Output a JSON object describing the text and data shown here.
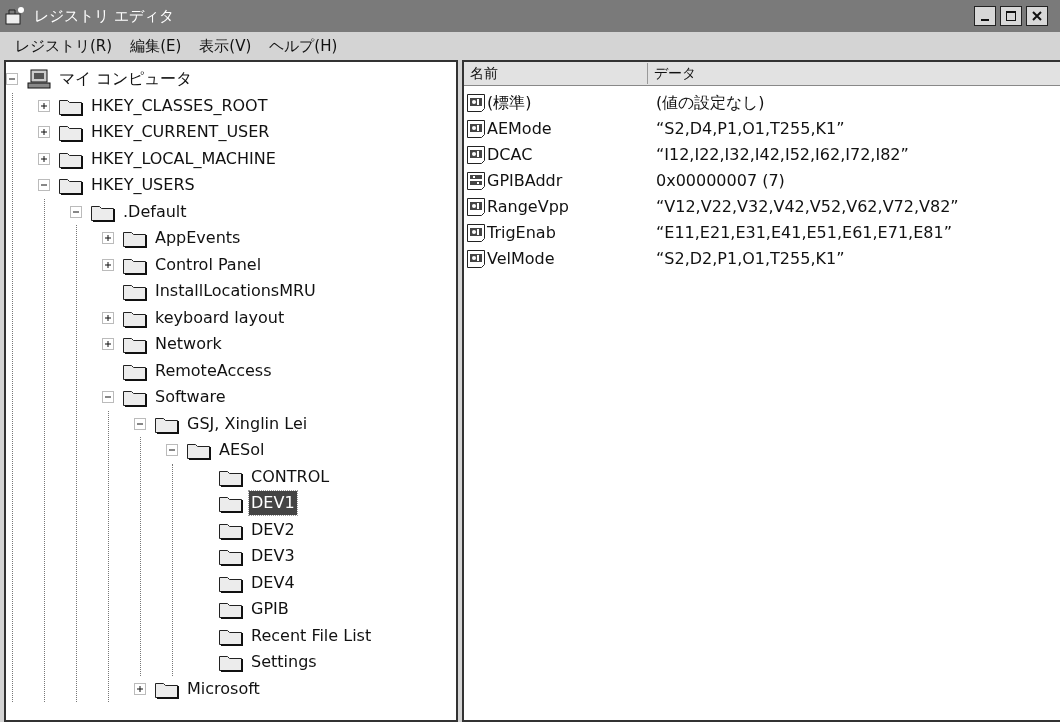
{
  "window": {
    "title": "レジストリ エディタ"
  },
  "menu": [
    "レジストリ(R)",
    "編集(E)",
    "表示(V)",
    "ヘルプ(H)"
  ],
  "tree": {
    "label": "マイ コンピュータ",
    "kind": "computer",
    "expanded": true,
    "selected": false,
    "children": [
      {
        "label": "HKEY_CLASSES_ROOT",
        "kind": "folder",
        "expanded": false,
        "selected": false
      },
      {
        "label": "HKEY_CURRENT_USER",
        "kind": "folder",
        "expanded": false,
        "selected": false
      },
      {
        "label": "HKEY_LOCAL_MACHINE",
        "kind": "folder",
        "expanded": false,
        "selected": false
      },
      {
        "label": "HKEY_USERS",
        "kind": "folder",
        "expanded": true,
        "selected": false,
        "children": [
          {
            "label": ".Default",
            "kind": "folder",
            "expanded": true,
            "selected": false,
            "children": [
              {
                "label": "AppEvents",
                "kind": "folder",
                "expanded": false,
                "selected": false
              },
              {
                "label": "Control Panel",
                "kind": "folder",
                "expanded": false,
                "selected": false
              },
              {
                "label": "InstallLocationsMRU",
                "kind": "folder",
                "selected": false
              },
              {
                "label": "keyboard layout",
                "kind": "folder",
                "expanded": false,
                "selected": false
              },
              {
                "label": "Network",
                "kind": "folder",
                "expanded": false,
                "selected": false
              },
              {
                "label": "RemoteAccess",
                "kind": "folder",
                "selected": false
              },
              {
                "label": "Software",
                "kind": "folder",
                "expanded": true,
                "selected": false,
                "children": [
                  {
                    "label": "GSJ, Xinglin Lei",
                    "kind": "folder",
                    "expanded": true,
                    "selected": false,
                    "children": [
                      {
                        "label": "AESol",
                        "kind": "folder",
                        "expanded": true,
                        "selected": false,
                        "children": [
                          {
                            "label": "CONTROL",
                            "kind": "folder",
                            "selected": false
                          },
                          {
                            "label": "DEV1",
                            "kind": "folder",
                            "selected": true
                          },
                          {
                            "label": "DEV2",
                            "kind": "folder",
                            "selected": false
                          },
                          {
                            "label": "DEV3",
                            "kind": "folder",
                            "selected": false
                          },
                          {
                            "label": "DEV4",
                            "kind": "folder",
                            "selected": false
                          },
                          {
                            "label": "GPIB",
                            "kind": "folder",
                            "selected": false
                          },
                          {
                            "label": "Recent File List",
                            "kind": "folder",
                            "selected": false
                          },
                          {
                            "label": "Settings",
                            "kind": "folder",
                            "selected": false
                          }
                        ]
                      }
                    ]
                  },
                  {
                    "label": "Microsoft",
                    "kind": "folder",
                    "expanded": false,
                    "selected": false
                  }
                ]
              }
            ]
          }
        ]
      }
    ]
  },
  "values": {
    "columns": [
      "名前",
      "データ"
    ],
    "rows": [
      {
        "kind": "string",
        "name": "(標準)",
        "data": "(値の設定なし)"
      },
      {
        "kind": "string",
        "name": "AEMode",
        "data": "“S2,D4,P1,O1,T255,K1”"
      },
      {
        "kind": "string",
        "name": "DCAC",
        "data": "“I12,I22,I32,I42,I52,I62,I72,I82”"
      },
      {
        "kind": "binary",
        "name": "GPIBAddr",
        "data": "0x00000007 (7)"
      },
      {
        "kind": "string",
        "name": "RangeVpp",
        "data": "“V12,V22,V32,V42,V52,V62,V72,V82”"
      },
      {
        "kind": "string",
        "name": "TrigEnab",
        "data": "“E11,E21,E31,E41,E51,E61,E71,E81”"
      },
      {
        "kind": "string",
        "name": "VelMode",
        "data": "“S2,D2,P1,O1,T255,K1”"
      }
    ]
  }
}
